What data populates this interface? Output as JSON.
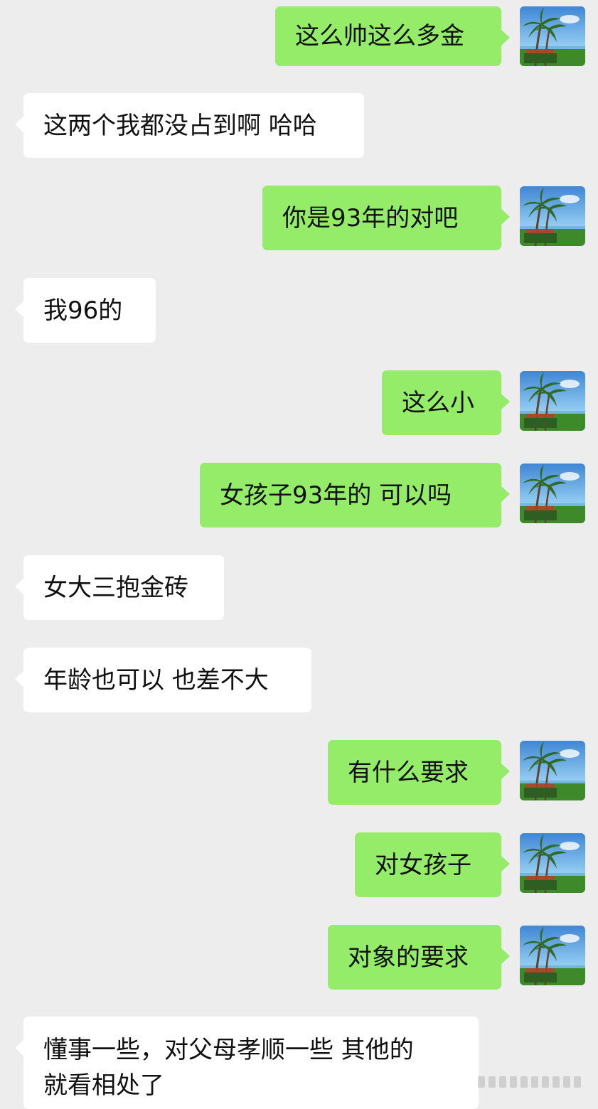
{
  "conversation": {
    "messages": [
      {
        "side": "out",
        "text": "这么帅这么多金"
      },
      {
        "side": "in",
        "text": "这两个我都没占到啊 哈哈"
      },
      {
        "side": "out",
        "text": "你是93年的对吧"
      },
      {
        "side": "in",
        "text": "我96的"
      },
      {
        "side": "out",
        "text": "这么小"
      },
      {
        "side": "out",
        "text": "女孩子93年的 可以吗"
      },
      {
        "side": "in",
        "text": "女大三抱金砖"
      },
      {
        "side": "in",
        "text": "年龄也可以 也差不大"
      },
      {
        "side": "out",
        "text": "有什么要求"
      },
      {
        "side": "out",
        "text": "对女孩子"
      },
      {
        "side": "out",
        "text": "对象的要求"
      },
      {
        "side": "in",
        "text": "懂事一些，对父母孝顺一些 其他的",
        "text_line2": "就看相处了"
      }
    ]
  },
  "avatar": {
    "icon": "palm-tree-avatar-icon"
  },
  "colors": {
    "background": "#ededed",
    "outgoing_bubble": "#95ec69",
    "incoming_bubble": "#ffffff",
    "text": "#111111"
  }
}
